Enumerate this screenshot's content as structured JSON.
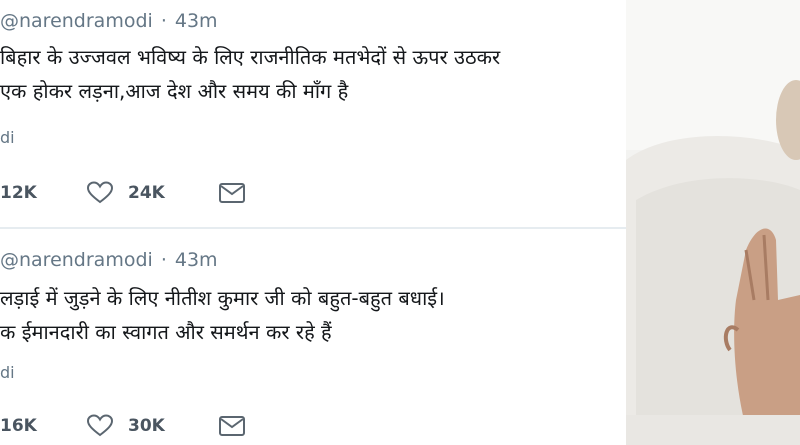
{
  "tweets": [
    {
      "handle": "@narendramodi",
      "time": "43m",
      "text_line1": "बिहार के उज्जवल भविष्य के लिए राजनीतिक मतभेदों से ऊपर उठकर",
      "text_line2": "एक होकर लड़ना,आज देश और समय की माँग है",
      "lang": "di",
      "retweets": "12K",
      "likes": "24K"
    },
    {
      "handle": "@narendramodi",
      "time": "43m",
      "text_line1": "लड़ाई में जुड़ने के लिए नीतीश कुमार जी को बहुत-बहुत बधाई।",
      "text_line2": "क ईमानदारी का स्वागत और समर्थन कर रहे हैं",
      "lang": "di",
      "retweets": "16K",
      "likes": "30K"
    }
  ],
  "separator": "·",
  "colors": {
    "meta_gray": "#657786",
    "text": "#14171a",
    "divider": "#e6ecf0"
  },
  "icons": [
    "heart-icon",
    "mail-icon"
  ]
}
